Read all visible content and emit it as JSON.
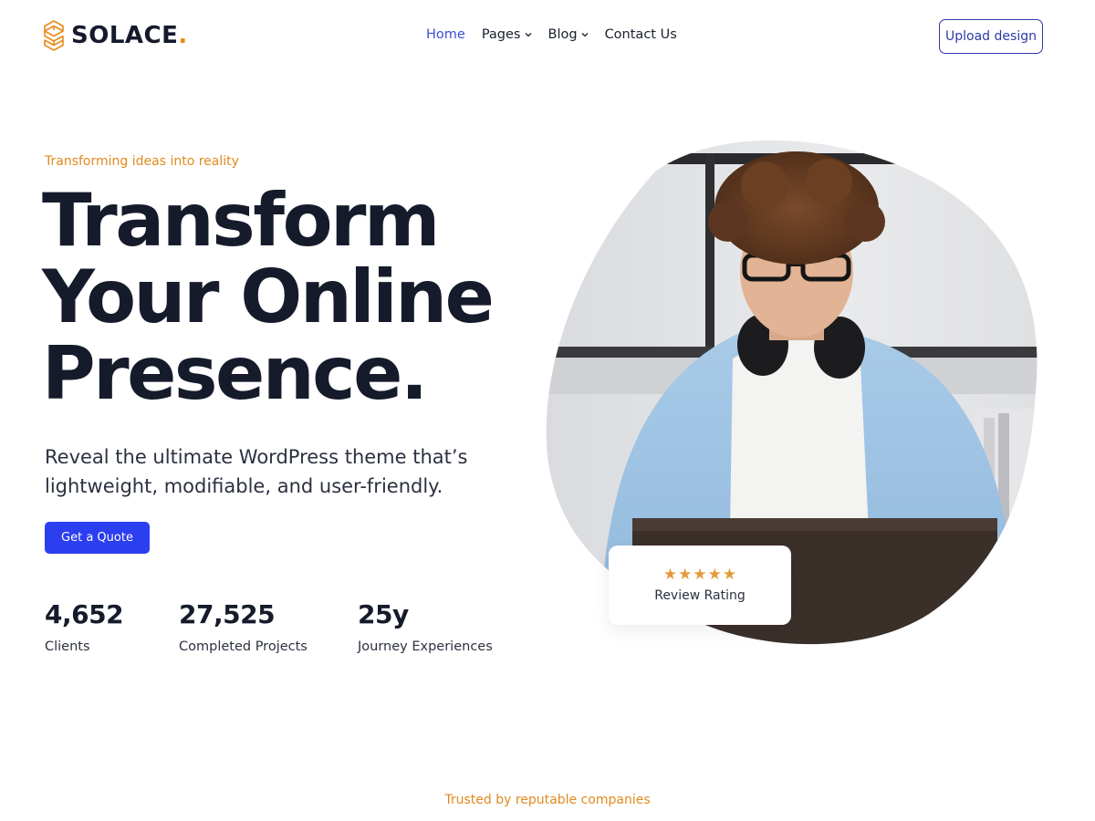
{
  "brand": {
    "name": "SOLACE",
    "dot": ".",
    "accent_color": "#e88a1a",
    "logo_icon": "hexagon-s-logo-icon"
  },
  "nav": {
    "items": [
      {
        "label": "Home",
        "active": true
      },
      {
        "label": "Pages",
        "has_dropdown": true
      },
      {
        "label": "Blog",
        "has_dropdown": true
      },
      {
        "label": "Contact Us"
      }
    ],
    "chevron": "⌄"
  },
  "header": {
    "upload_label": "Upload design"
  },
  "hero": {
    "eyebrow": "Transforming ideas into reality",
    "title_lines": [
      "Transform",
      "Your Online",
      "Presence."
    ],
    "subtitle": "Reveal the ultimate WordPress theme that’s lightweight, modifiable, and user-friendly.",
    "cta_label": "Get a Quote",
    "image_alt_icon": "person-with-laptop-photo"
  },
  "stats": [
    {
      "value": "4,652",
      "label": "Clients"
    },
    {
      "value": "27,525",
      "label": "Completed Projects"
    },
    {
      "value": "25y",
      "label": "Journey Experiences"
    }
  ],
  "rating": {
    "stars": 5,
    "star_glyph": "★",
    "label": "Review Rating",
    "star_color": "#e59a3b"
  },
  "trusted": {
    "label": "Trusted by reputable companies"
  },
  "colors": {
    "primary": "#2b3ef0",
    "nav_active": "#3a4fd8",
    "heading": "#161b2c",
    "accent": "#e08a1e"
  }
}
